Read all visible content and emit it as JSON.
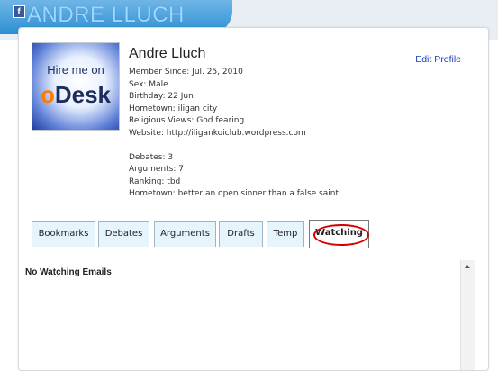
{
  "header": {
    "fb_badge": "f",
    "title": "ANDRE LLUCH"
  },
  "profile": {
    "photo": {
      "line1": "Hire me on",
      "line2_o": "o",
      "line2_rest": "Desk"
    },
    "name": "Andre Lluch",
    "edit_profile": "Edit Profile",
    "details": [
      "Member Since: Jul. 25, 2010",
      "Sex: Male",
      "Birthday: 22 Jun",
      "Hometown: iligan city",
      "Religious Views: God fearing",
      "Website: http://iligankoiclub.wordpress.com"
    ],
    "stats": [
      "Debates: 3",
      "Arguments: 7",
      "Ranking: tbd",
      "Hometown: better an open sinner than a false saint"
    ]
  },
  "tabs": [
    {
      "label": "Bookmarks"
    },
    {
      "label": "Debates"
    },
    {
      "label": "Arguments"
    },
    {
      "label": "Drafts"
    },
    {
      "label": "Temp"
    },
    {
      "label": "Watching",
      "active": true
    }
  ],
  "content": {
    "empty_message": "No Watching Emails"
  },
  "colors": {
    "banner": "#2c8fd3",
    "tab_bg": "#e6f4fb",
    "highlight_ring": "#d40000",
    "link": "#1a3fbf"
  }
}
